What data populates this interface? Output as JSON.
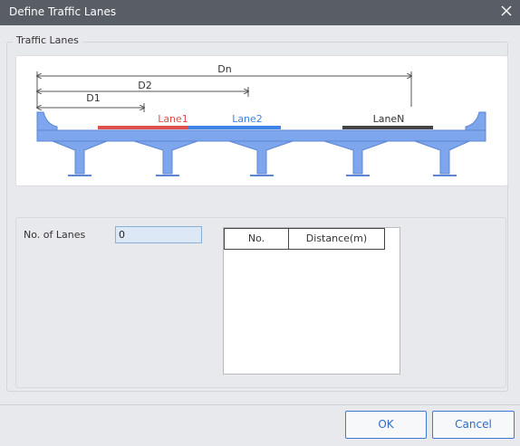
{
  "window": {
    "title": "Define Traffic Lanes"
  },
  "group": {
    "title": "Traffic Lanes"
  },
  "diagram": {
    "dim_labels": [
      "Dn",
      "D2",
      "D1"
    ],
    "lanes": [
      {
        "label": "Lane1",
        "color": "#e0504a"
      },
      {
        "label": "Lane2",
        "color": "#3e83e6"
      },
      {
        "label": "LaneN",
        "color": "#444444"
      }
    ],
    "deck_color": "#7da6ec"
  },
  "form": {
    "lanes_label": "No. of Lanes",
    "lanes_value": "0"
  },
  "table": {
    "headers": [
      "No.",
      "Distance(m)"
    ],
    "rows": []
  },
  "buttons": {
    "ok": "OK",
    "cancel": "Cancel"
  }
}
